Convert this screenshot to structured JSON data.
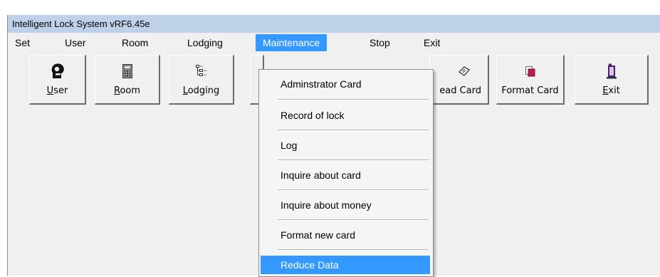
{
  "window": {
    "title": "Intelligent Lock System vRF6.45e"
  },
  "menubar": {
    "items": [
      {
        "label": "Set"
      },
      {
        "label": "User"
      },
      {
        "label": "Room"
      },
      {
        "label": "Lodging"
      },
      {
        "label": "Maintenance",
        "active": true
      },
      {
        "label": "Stop"
      },
      {
        "label": "Exit"
      }
    ]
  },
  "toolbar": {
    "buttons": [
      {
        "label": "User",
        "mnemonic": "U",
        "rest": "ser",
        "icon": "user-head-icon"
      },
      {
        "label": "Room",
        "mnemonic": "R",
        "rest": "oom",
        "icon": "room-keypad-icon"
      },
      {
        "label": "Lodging",
        "mnemonic": "L",
        "rest": "odging",
        "icon": "lodging-tree-icon"
      },
      {
        "label": "ead Card",
        "icon": "card-eye-icon"
      },
      {
        "label": "Format Card",
        "icon": "format-card-icon"
      },
      {
        "label": "Exit",
        "mnemonic": "E",
        "rest": "xit",
        "icon": "exit-door-icon"
      }
    ]
  },
  "maintenance_menu": {
    "items": [
      {
        "label": "Adminstrator Card"
      },
      {
        "label": "Record of lock"
      },
      {
        "label": "Log"
      },
      {
        "label": "Inquire about card"
      },
      {
        "label": "Inquire about  money"
      },
      {
        "label": "Format new card"
      },
      {
        "label": "Reduce Data",
        "selected": true
      }
    ]
  },
  "colors": {
    "titlebar": "#bed1e8",
    "highlight": "#3399ff",
    "face": "#f0f0f0"
  }
}
